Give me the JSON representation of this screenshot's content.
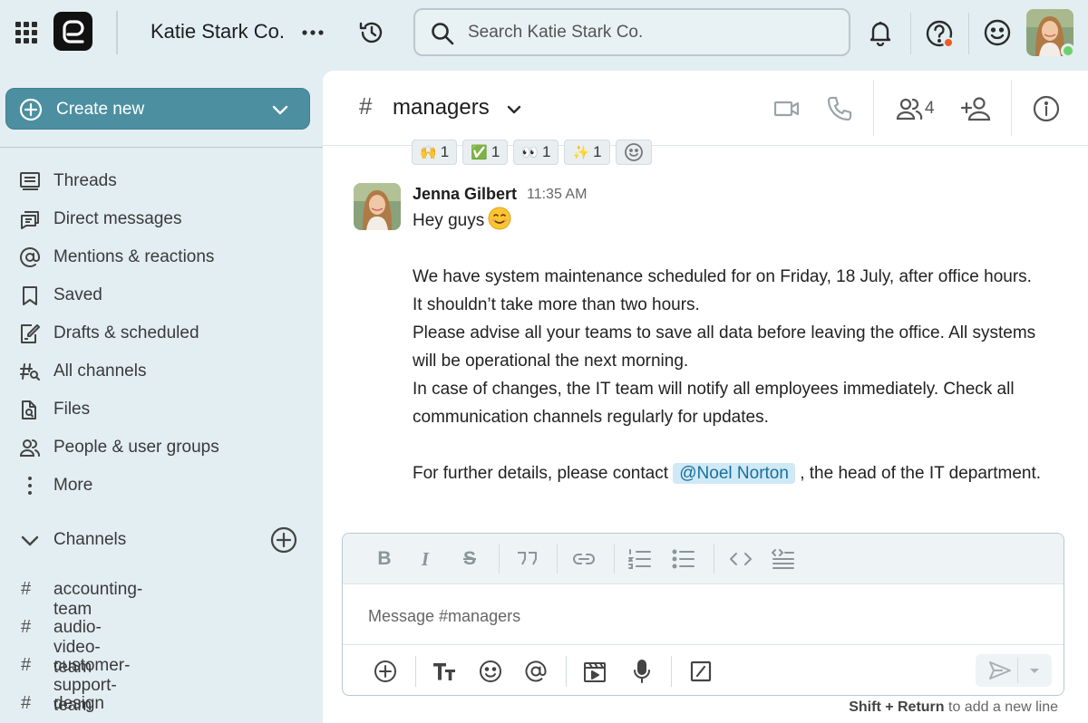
{
  "topbar": {
    "company": "Katie Stark Co.",
    "search_placeholder": "Search Katie Stark Co."
  },
  "sidebar": {
    "create_label": "Create new",
    "nav": [
      {
        "label": "Threads",
        "icon": "threads-icon"
      },
      {
        "label": "Direct messages",
        "icon": "direct-messages-icon"
      },
      {
        "label": "Mentions & reactions",
        "icon": "at-icon"
      },
      {
        "label": "Saved",
        "icon": "bookmark-icon"
      },
      {
        "label": "Drafts & scheduled",
        "icon": "drafts-icon"
      },
      {
        "label": "All channels",
        "icon": "channel-search-icon"
      },
      {
        "label": "Files",
        "icon": "file-search-icon"
      },
      {
        "label": "People & user groups",
        "icon": "people-icon"
      },
      {
        "label": "More",
        "icon": "kebab-icon"
      }
    ],
    "channels_label": "Channels",
    "channels": [
      "accounting-team",
      "audio-video-team",
      "customer-support-team",
      "design"
    ]
  },
  "channel": {
    "hash": "#",
    "name": "managers",
    "member_count": "4"
  },
  "reactions": [
    {
      "emoji": "🙌",
      "count": "1"
    },
    {
      "emoji": "✅",
      "count": "1"
    },
    {
      "emoji": "👀",
      "count": "1"
    },
    {
      "emoji": "✨",
      "count": "1"
    }
  ],
  "message": {
    "author": "Jenna Gilbert",
    "time": "11:35 AM",
    "line1": "Hey guys",
    "line2": "We have system maintenance scheduled for on Friday, 18 July, after office hours.",
    "line3": "It shouldn’t take more than two hours.",
    "line4": "Please advise all your teams to save all data before leaving the office. All systems will be operational the next morning.",
    "line5": "In case of changes, the IT team will notify all employees immediately. Check all communication channels regularly for updates.",
    "line6_before": "For further details, please contact",
    "mention": "@Noel Norton",
    "line6_after": ", the head of the IT department."
  },
  "composer": {
    "placeholder": "Message #managers",
    "hint_keys": "Shift + Return",
    "hint_text": "to add a new line"
  },
  "colors": {
    "accent": "#4c8fa1",
    "background": "#e3eef2",
    "mention_bg": "#cfe9f7",
    "status_online": "#6bd26b",
    "help_badge": "#ef5a24"
  }
}
